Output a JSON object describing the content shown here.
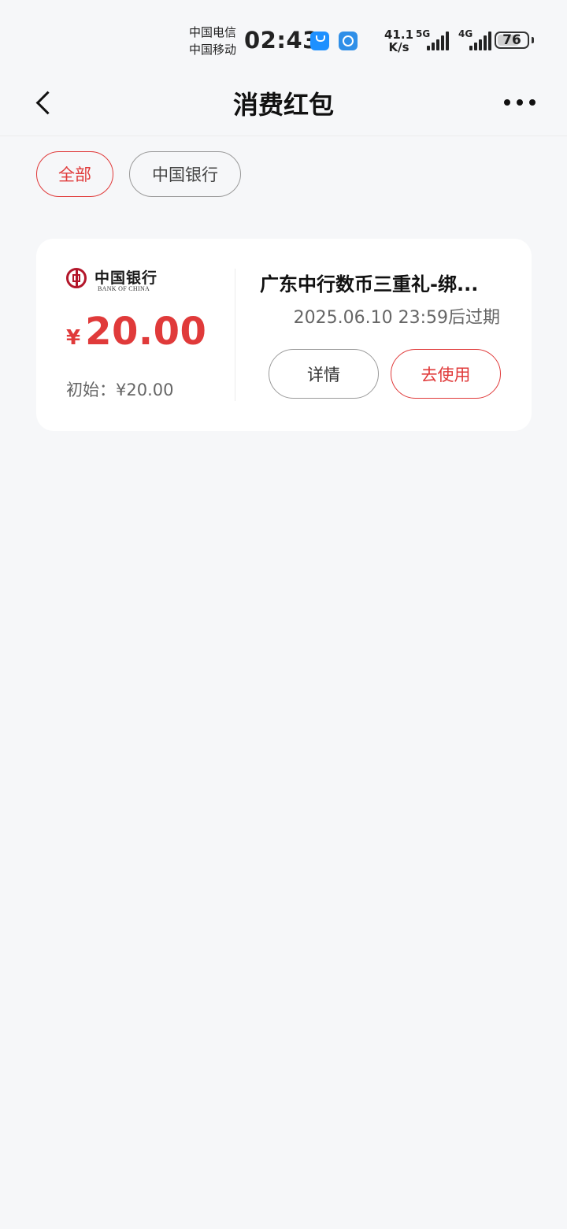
{
  "status_bar": {
    "carrier_1": "中国电信",
    "carrier_2": "中国移动",
    "time": "02:43",
    "net_speed_value": "41.1",
    "net_speed_unit": "K/s",
    "signal_1_label": "5G",
    "signal_2_label": "4G",
    "battery_level": "76",
    "battery_fraction": 0.76
  },
  "header": {
    "title": "消费红包"
  },
  "filters": [
    {
      "label": "全部",
      "active": true
    },
    {
      "label": "中国银行",
      "active": false
    }
  ],
  "card": {
    "bank_name_cn": "中国银行",
    "bank_name_en": "BANK OF CHINA",
    "currency_symbol": "¥",
    "amount": "20.00",
    "initial_text": "初始：¥20.00",
    "title": "广东中行数币三重礼-绑...",
    "expiry": "2025.06.10 23:59后过期",
    "detail_label": "详情",
    "use_label": "去使用"
  },
  "colors": {
    "accent": "#e03a3a",
    "boc_red": "#b3162a",
    "background": "#f6f7f9"
  }
}
